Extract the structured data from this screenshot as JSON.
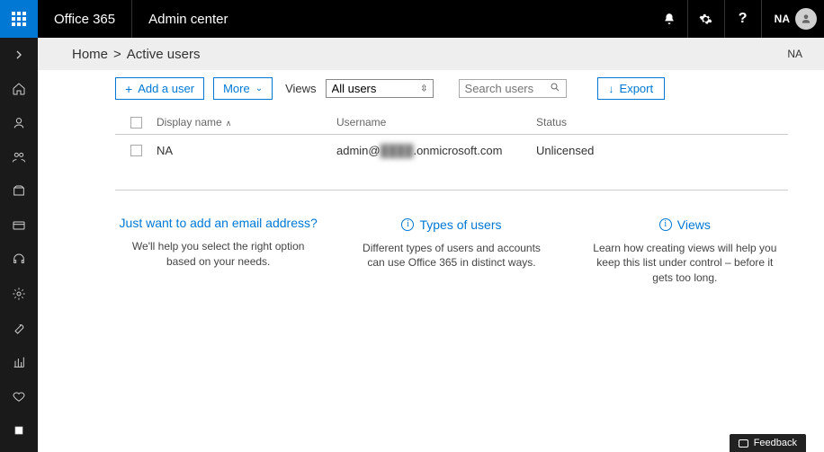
{
  "header": {
    "brand": "Office 365",
    "app_title": "Admin center",
    "user_initials": "NA"
  },
  "breadcrumb": {
    "home": "Home",
    "sep": ">",
    "current": "Active users",
    "right_label": "NA"
  },
  "toolbar": {
    "add_user": "Add a user",
    "more": "More",
    "views_label": "Views",
    "views_selected": "All users",
    "search_placeholder": "Search users",
    "export": "Export"
  },
  "table": {
    "headers": {
      "display_name": "Display name",
      "username": "Username",
      "status": "Status"
    },
    "rows": [
      {
        "display_name": "NA",
        "username_prefix": "admin@",
        "username_blur": "████",
        "username_suffix": ".onmicrosoft.com",
        "status": "Unlicensed"
      }
    ]
  },
  "cards": [
    {
      "title": "Just want to add an email address?",
      "desc": "We'll help you select the right option based on your needs.",
      "has_info_icon": false
    },
    {
      "title": "Types of users",
      "desc": "Different types of users and accounts can use Office 365 in distinct ways.",
      "has_info_icon": true
    },
    {
      "title": "Views",
      "desc": "Learn how creating views will help you keep this list under control – before it gets too long.",
      "has_info_icon": true
    }
  ],
  "feedback": {
    "label": "Feedback"
  }
}
